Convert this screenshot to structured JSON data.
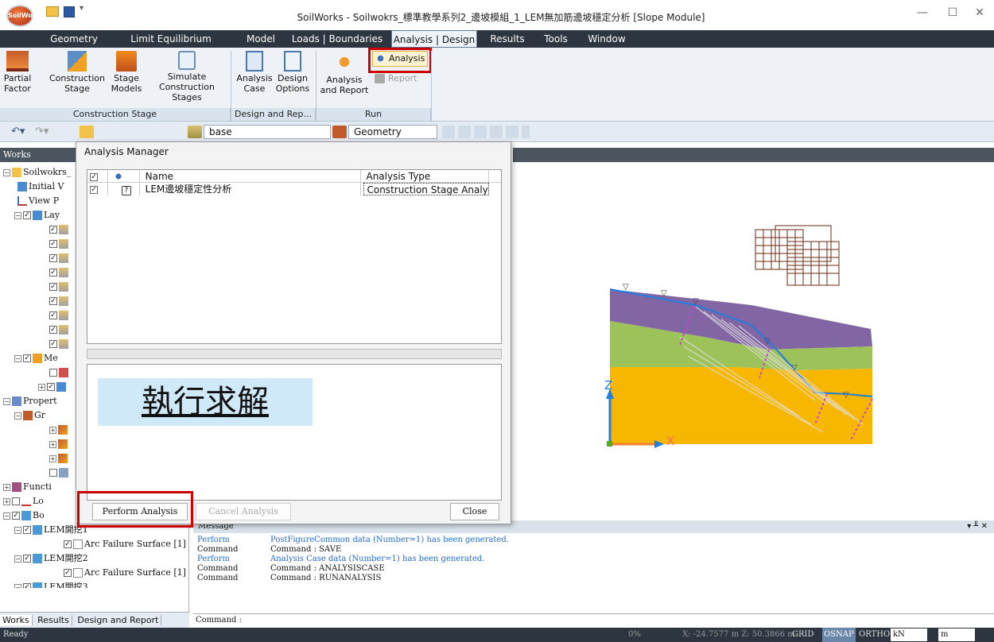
{
  "window": {
    "title": "SoilWorks - Soilwokrs_標準教學系列2_邊坡模組_1_LEM無加筋邊坡穩定分析 [Slope Module]",
    "app_logo": "SoilWorks",
    "minimize": "—",
    "maximize": "☐",
    "close": "✕"
  },
  "menu": [
    "Geometry",
    "Limit Equilibrium Method",
    "Model",
    "Loads | Boundaries",
    "Analysis | Design",
    "Results",
    "Tools",
    "Window"
  ],
  "ribbon": {
    "groups": [
      {
        "label": "Construction Stage",
        "buttons": [
          {
            "line1": "Partial",
            "line2": "Factor",
            "icon": "partial-factor-icon"
          },
          {
            "line1": "Construction",
            "line2": "Stage",
            "icon": "construction-stage-icon"
          },
          {
            "line1": "Stage",
            "line2": "Models",
            "icon": "stage-models-icon"
          },
          {
            "line1": "Simulate",
            "line2": "Construction Stages",
            "icon": "simulate-icon"
          }
        ]
      },
      {
        "label": "Design and Rep...",
        "buttons": [
          {
            "line1": "Analysis",
            "line2": "Case",
            "icon": "analysis-case-icon"
          },
          {
            "line1": "Design",
            "line2": "Options",
            "icon": "design-options-icon"
          }
        ]
      },
      {
        "label": "Run",
        "buttons": [
          {
            "line1": "Analysis",
            "line2": "and Report",
            "icon": "analysis-report-icon"
          }
        ]
      }
    ],
    "run_analysis": "Analysis",
    "run_report": "Report"
  },
  "toolbar": {
    "layer_combo": "base",
    "view_combo": "Geometry"
  },
  "works_panel": {
    "header": "Works",
    "tree": [
      {
        "label": "Soilwokrs_",
        "indent": 0
      },
      {
        "label": "Initial V",
        "indent": 1
      },
      {
        "label": "View P",
        "indent": 1
      },
      {
        "label": "Lay",
        "indent": 1
      },
      {
        "label": "Me",
        "indent": 1
      },
      {
        "label": "Propert",
        "indent": 0
      },
      {
        "label": "Gr",
        "indent": 1
      },
      {
        "label": "Functi",
        "indent": 0
      },
      {
        "label": "Lo",
        "indent": 0
      },
      {
        "label": "Bo",
        "indent": 0
      },
      {
        "label": "LEM開挖1",
        "indent": 1
      },
      {
        "label": "Arc Failure Surface [1]",
        "indent": 2
      },
      {
        "label": "LEM開挖2",
        "indent": 1
      },
      {
        "label": "Arc Failure Surface [1]",
        "indent": 2
      },
      {
        "label": "LEM開挖3",
        "indent": 1
      }
    ],
    "tabs": [
      "Works",
      "Results",
      "Design and Report"
    ]
  },
  "dialog": {
    "title": "Analysis Manager",
    "columns": [
      "Name",
      "Analysis Type"
    ],
    "rows": [
      {
        "name": "LEM邊坡穩定性分析",
        "type": "Construction Stage Analysis",
        "status": "?"
      }
    ],
    "annotation": "執行求解",
    "buttons": {
      "perform": "Perform Analysis",
      "cancel": "Cancel Analysis",
      "close": "Close"
    }
  },
  "viewport": {
    "axis_z": "Z",
    "axis_x": "X",
    "colors": {
      "purple": "#8266a4",
      "green": "#9dc25a",
      "orange": "#f7b600",
      "water": "#1f7fe0"
    }
  },
  "messages": {
    "title": "Message",
    "rows": [
      {
        "type": "Perform",
        "text": "PostFigureCommon data (Number=1) has been generated.",
        "blue": true
      },
      {
        "type": "Command",
        "text": "Command : SAVE",
        "blue": false
      },
      {
        "type": "Perform",
        "text": "Analysis Case data (Number=1) has been generated.",
        "blue": true
      },
      {
        "type": "Command",
        "text": "Command : ANALYSISCASE",
        "blue": false
      },
      {
        "type": "Command",
        "text": "Command : RUNANALYSIS",
        "blue": false
      }
    ],
    "command_label": "Command :"
  },
  "status": {
    "ready": "Ready",
    "percent": "0%",
    "coords": "X: -24.7577 m  Z: 50.3866 m",
    "grid": "GRID",
    "osnap": "OSNAP",
    "ortho": "ORTHO",
    "unit_force": "kN",
    "unit_length": "m"
  }
}
